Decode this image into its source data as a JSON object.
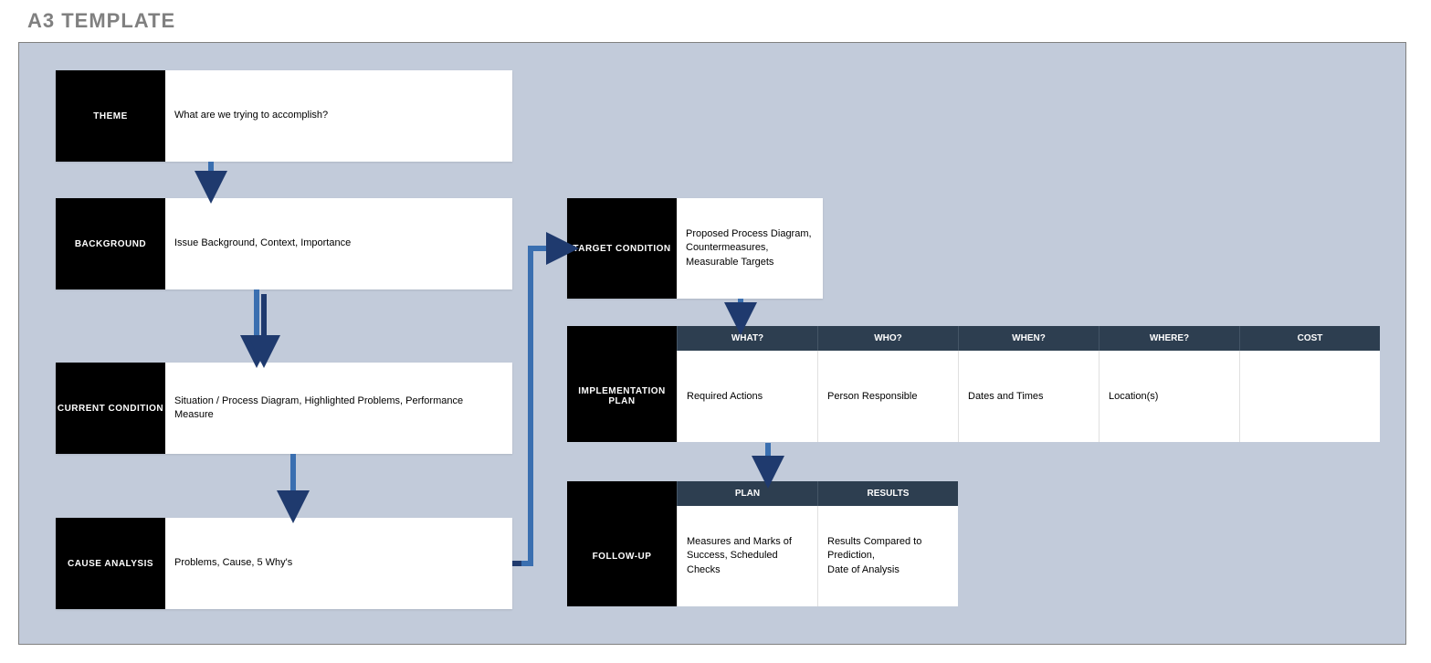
{
  "page": {
    "title": "A3 TEMPLATE"
  },
  "boxes": {
    "theme": {
      "label": "THEME",
      "text": "What are we trying to accomplish?"
    },
    "background": {
      "label": "BACKGROUND",
      "text": "Issue Background, Context, Importance"
    },
    "current": {
      "label": "CURRENT CONDITION",
      "text": "Situation / Process Diagram, Highlighted Problems, Performance Measure"
    },
    "cause": {
      "label": "CAUSE ANALYSIS",
      "text": "Problems, Cause, 5 Why's"
    },
    "target": {
      "label": "TARGET CONDITION",
      "text": "Proposed Process Diagram, Countermeasures, Measurable Targets"
    }
  },
  "implementation": {
    "label": "IMPLEMENTATION PLAN",
    "headers": [
      "WHAT?",
      "WHO?",
      "WHEN?",
      "WHERE?",
      "COST"
    ],
    "row": [
      "Required Actions",
      "Person Responsible",
      "Dates and Times",
      "Location(s)",
      ""
    ]
  },
  "followup": {
    "label": "FOLLOW-UP",
    "headers": [
      "PLAN",
      "RESULTS"
    ],
    "row": [
      "Measures and Marks of Success, Scheduled Checks",
      "Results Compared to Prediction,\nDate of Analysis"
    ]
  },
  "colors": {
    "arrow_blue": "#3a6fb0",
    "arrow_dark": "#1f3a6e",
    "header_bg": "#2d3e50"
  }
}
